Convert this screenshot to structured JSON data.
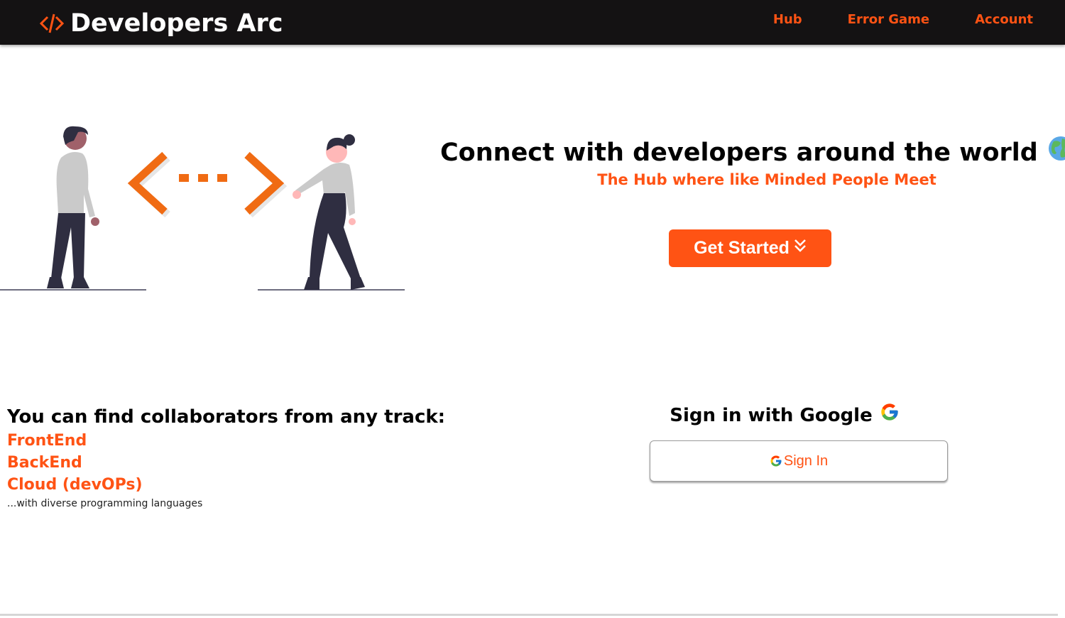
{
  "navbar": {
    "brand": "Developers Arc",
    "links": [
      "Hub",
      "Error Game",
      "Account"
    ]
  },
  "hero": {
    "title": "Connect with developers around the world",
    "subtitle": "The Hub where like Minded People Meet",
    "cta": "Get Started"
  },
  "tracks": {
    "heading": "You can find collaborators from any track:",
    "items": [
      "FrontEnd",
      "BackEnd",
      "Cloud (devOPs)"
    ],
    "note": "...with diverse programming languages"
  },
  "signin": {
    "heading": "Sign in with Google",
    "button": "Sign In"
  },
  "colors": {
    "accent": "#ff5314",
    "navbar": "#141213",
    "text": "#000000"
  },
  "icons": [
    "code-brackets-icon",
    "globe-icon",
    "double-chevron-down-icon",
    "google-icon"
  ]
}
